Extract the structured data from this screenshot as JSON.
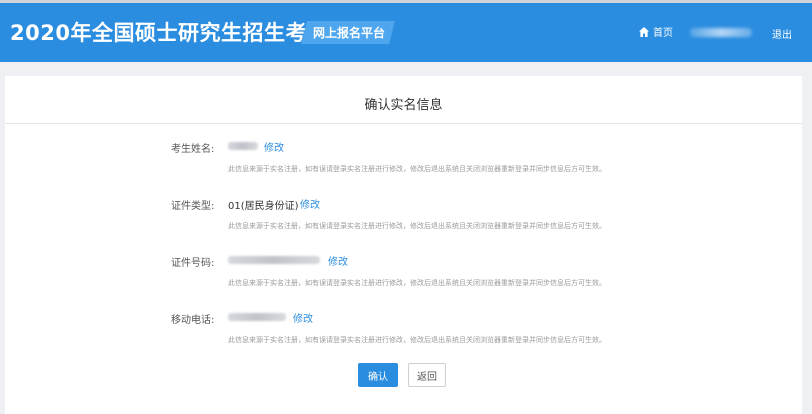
{
  "header": {
    "title": "2020年全国硕士研究生招生考试",
    "platform_badge": "网上报名平台",
    "home_label": "首页",
    "logout_label": "退出",
    "icons": {
      "home": "home-icon"
    }
  },
  "card": {
    "title": "确认实名信息",
    "fields": [
      {
        "label": "考生姓名:",
        "value": "",
        "edit_label": "修改",
        "note": "此信息来源于实名注册，如有误请登录实名注册进行修改，修改后退出系统且关闭浏览器重新登录并同步信息后方可生效。"
      },
      {
        "label": "证件类型:",
        "value": "01(居民身份证)",
        "edit_label": "修改",
        "note": "此信息来源于实名注册，如有误请登录实名注册进行修改，修改后退出系统且关闭浏览器重新登录并同步信息后方可生效。"
      },
      {
        "label": "证件号码:",
        "value": "",
        "edit_label": "修改",
        "note": "此信息来源于实名注册，如有误请登录实名注册进行修改，修改后退出系统且关闭浏览器重新登录并同步信息后方可生效。"
      },
      {
        "label": "移动电话:",
        "value": "",
        "edit_label": "修改",
        "note": "此信息来源于实名注册，如有误请登录实名注册进行修改，修改后退出系统且关闭浏览器重新登录并同步信息后方可生效。"
      }
    ],
    "confirm_label": "确认",
    "back_label": "返回"
  },
  "colors": {
    "header_bg": "#2b8de0",
    "badge_bg": "#4ea6ee",
    "link": "#2b8de0",
    "page_bg": "#eef0f3"
  }
}
